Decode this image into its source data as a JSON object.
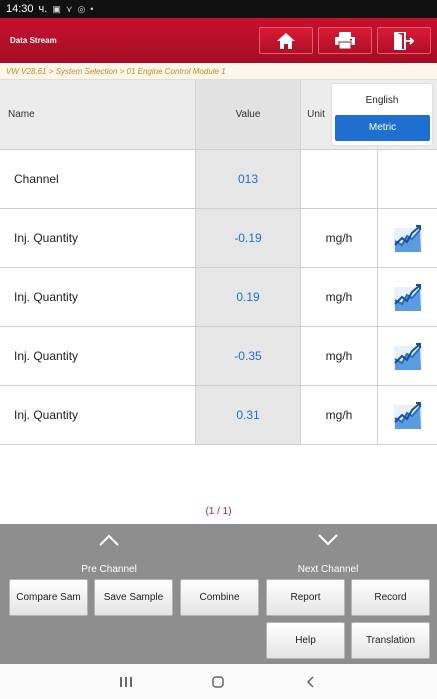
{
  "status_bar": {
    "time": "14:30",
    "carrier": "ч.",
    "icons": [
      "image-icon",
      "vpn-icon",
      "sync-icon",
      "dot-icon"
    ]
  },
  "header": {
    "title": "Data Stream",
    "buttons": [
      {
        "icon": "home-icon"
      },
      {
        "icon": "printer-icon"
      },
      {
        "icon": "exit-icon"
      }
    ]
  },
  "breadcrumb": "VW V28.61 > System Selection > 01 Engine Control Module 1",
  "table": {
    "columns": {
      "name": "Name",
      "value": "Value",
      "unit": "Unit"
    },
    "unit_toggle": {
      "english": "English",
      "metric": "Metric",
      "selected": "Metric"
    },
    "rows": [
      {
        "name": "Channel",
        "value": "013",
        "unit": "",
        "graph": false
      },
      {
        "name": "Inj. Quantity",
        "value": "-0.19",
        "unit": "mg/h",
        "graph": true
      },
      {
        "name": "Inj. Quantity",
        "value": "0.19",
        "unit": "mg/h",
        "graph": true
      },
      {
        "name": "Inj. Quantity",
        "value": "-0.35",
        "unit": "mg/h",
        "graph": true
      },
      {
        "name": "Inj. Quantity",
        "value": "0.31",
        "unit": "mg/h",
        "graph": true
      }
    ]
  },
  "pager": "(1 / 1)",
  "nav": {
    "prev": "Pre Channel",
    "next": "Next Channel"
  },
  "functions": {
    "compare": "Compare Sam",
    "save": "Save Sample",
    "combine": "Combine",
    "report": "Report",
    "record": "Record",
    "help": "Help",
    "translation": "Translation"
  },
  "colors": {
    "header_red": "#c8102e",
    "accent_blue": "#1e6fd1",
    "breadcrumb_text": "#c58a2c",
    "panel_gray": "#8e8e8e"
  }
}
